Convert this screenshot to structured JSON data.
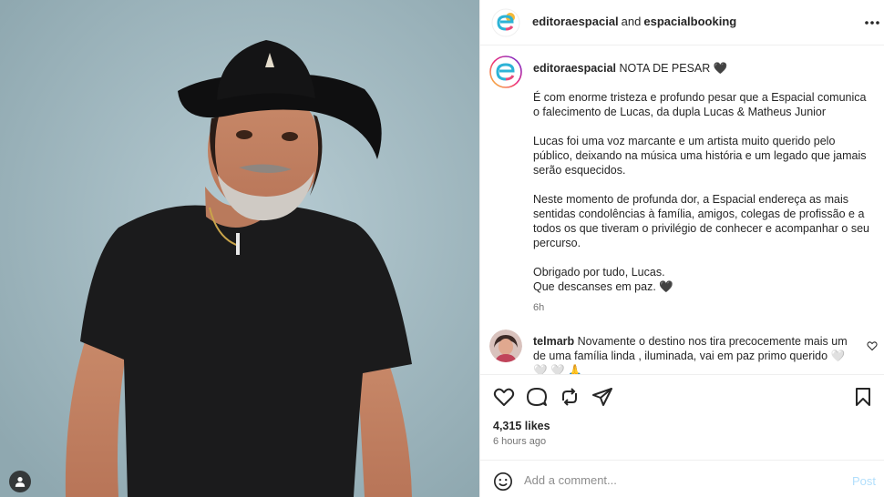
{
  "header": {
    "author": "editoraespacial",
    "connector": "and",
    "collaborator": "espacialbooking",
    "more_icon": "more-horizontal-icon"
  },
  "caption": {
    "username": "editoraespacial",
    "title": "NOTA DE PESAR",
    "title_emoji": "🖤",
    "paragraphs": [
      "É com enorme tristeza e profundo pesar que a Espacial comunica o falecimento de Lucas, da dupla Lucas & Matheus Junior",
      "Lucas foi uma voz marcante e um artista muito querido pelo público, deixando na música uma história e um legado que jamais serão esquecidos.",
      "Neste momento de profunda dor, a Espacial endereça as mais sentidas condolências à família, amigos, colegas de profissão e a todos os que tiveram o privilégio de conhecer e acompanhar o seu percurso."
    ],
    "closing_line1": "Obrigado por tudo, Lucas.",
    "closing_line2": "Que descanses em paz.",
    "closing_emoji": "🖤",
    "time": "6h"
  },
  "comment": {
    "username": "telmarb",
    "text": "Novamente o destino nos tira precocemente mais um de uma família linda , iluminada, vai em paz primo querido",
    "emojis": "🤍 🤍 🤍 🙏"
  },
  "actions": {
    "icons": [
      "heart-icon",
      "comment-icon",
      "repost-icon",
      "share-icon",
      "bookmark-icon"
    ]
  },
  "likes": "4,315 likes",
  "posted_ago": "6 hours ago",
  "add_comment": {
    "placeholder": "Add a comment...",
    "post_label": "Post"
  },
  "colors": {
    "text": "#262626",
    "secondary": "#737373",
    "post_button_disabled": "#b2dffc",
    "border": "#efefef"
  }
}
